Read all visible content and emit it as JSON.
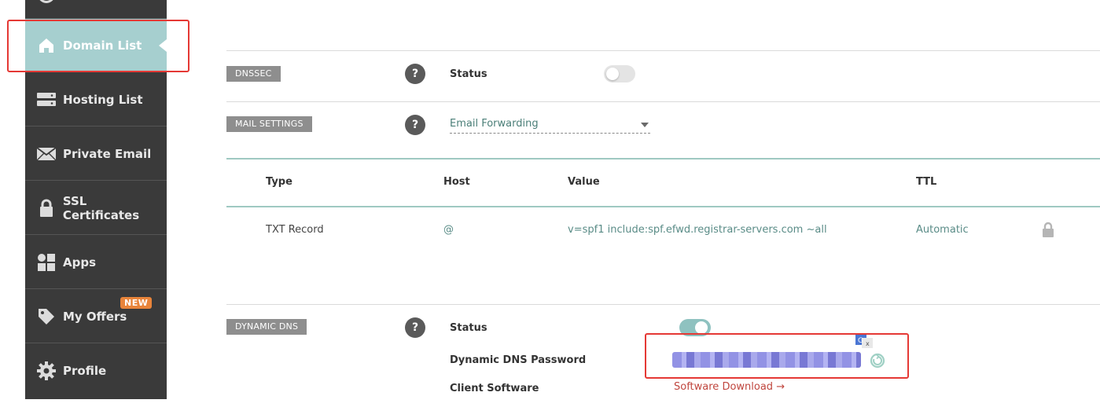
{
  "sidebar": {
    "items": [
      {
        "label": "Domain List",
        "icon": "home-icon",
        "active": true
      },
      {
        "label": "Hosting List",
        "icon": "server-icon"
      },
      {
        "label": "Private Email",
        "icon": "envelope-icon"
      },
      {
        "label": "SSL Certificates",
        "icon": "lock-icon"
      },
      {
        "label": "Apps",
        "icon": "apps-icon"
      },
      {
        "label": "My Offers",
        "icon": "tag-icon",
        "badge": "NEW"
      },
      {
        "label": "Profile",
        "icon": "gear-icon"
      }
    ]
  },
  "dnssec": {
    "tag": "DNSSEC",
    "help": "?",
    "status_label": "Status",
    "enabled": false
  },
  "mail_settings": {
    "tag": "MAIL SETTINGS",
    "help": "?",
    "selected": "Email Forwarding",
    "table": {
      "headers": [
        "Type",
        "Host",
        "Value",
        "TTL"
      ],
      "rows": [
        {
          "type": "TXT Record",
          "host": "@",
          "value": "v=spf1 include:spf.efwd.registrar-servers.com ~all",
          "ttl": "Automatic"
        }
      ]
    }
  },
  "dynamic_dns": {
    "tag": "DYNAMIC DNS",
    "help": "?",
    "status_label": "Status",
    "enabled": true,
    "password_label": "Dynamic DNS Password",
    "client_label": "Client Software",
    "download_link": "Software Download →"
  },
  "colors": {
    "sidebar_bg": "#3a3a3a",
    "active_bg": "#a6cfcf",
    "badge": "#e8843a",
    "highlight": "#e53935",
    "link": "#c0463e"
  }
}
